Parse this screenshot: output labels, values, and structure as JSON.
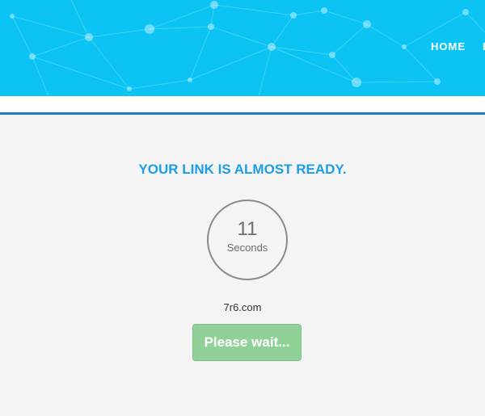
{
  "header": {
    "nav": {
      "home_label": "HOME",
      "more_label": "I"
    },
    "colors": {
      "banner": "#0bc4f4",
      "network": "#ffffff"
    }
  },
  "main": {
    "title": "YOUR LINK IS ALMOST READY.",
    "timer": {
      "value": "11",
      "unit": "Seconds"
    },
    "domain": "7r6.com",
    "button_label": "Please wait...",
    "colors": {
      "title": "#1b9ee5",
      "button": "#8fd197",
      "rule": "#1f7ccc"
    }
  }
}
